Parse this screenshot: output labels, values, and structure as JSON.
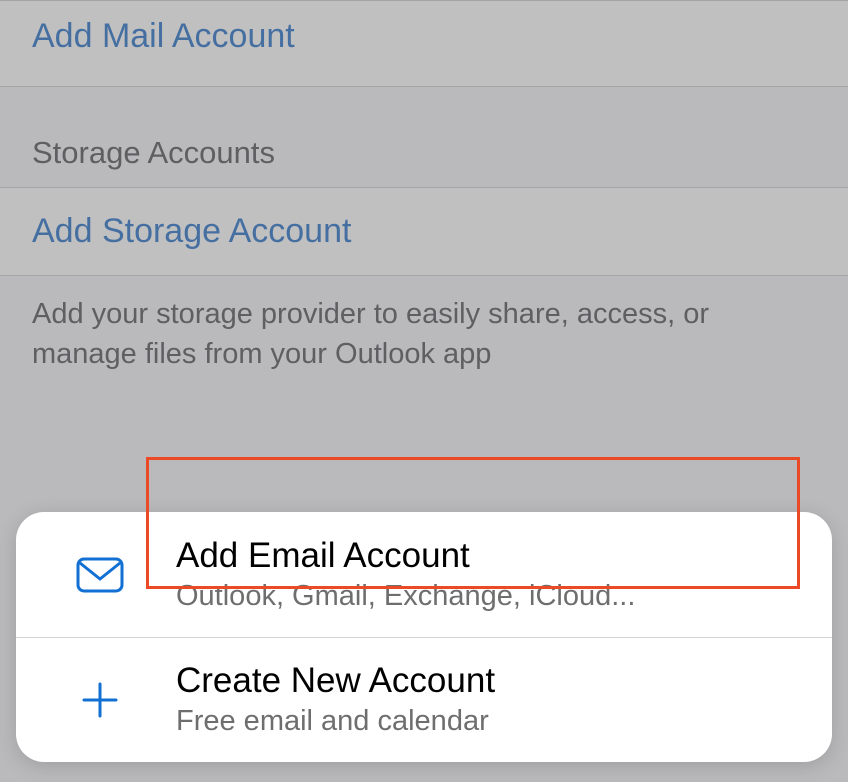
{
  "main": {
    "add_mail_label": "Add Mail Account",
    "storage_section_header": "Storage Accounts",
    "add_storage_label": "Add Storage Account",
    "storage_footer": "Add your storage provider to easily share, access, or manage files from your Outlook app"
  },
  "sheet": {
    "items": [
      {
        "title": "Add Email Account",
        "subtitle": "Outlook, Gmail, Exchange, iCloud...",
        "icon": "mail-icon"
      },
      {
        "title": "Create New Account",
        "subtitle": "Free email and calendar",
        "icon": "plus-icon"
      }
    ]
  },
  "colors": {
    "link": "#0a5cc0",
    "highlight": "#ec4a27",
    "icon": "#1270d4"
  }
}
